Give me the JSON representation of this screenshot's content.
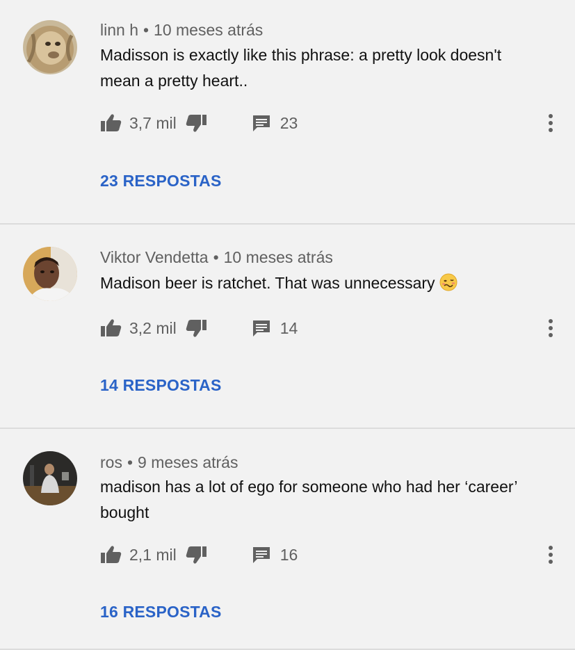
{
  "comments": [
    {
      "author": "linn h",
      "time": "10 meses atrás",
      "text": "Madisson is exactly like this phrase: a pretty look doesn't mean a pretty heart..",
      "likes": "3,7 mil",
      "reply_count": "23",
      "replies_label": "23 RESPOSTAS",
      "avatar_icon": "lion-photo"
    },
    {
      "author": "Viktor Vendetta",
      "time": "10 meses atrás",
      "text": "Madison beer is ratchet. That was unnecessary",
      "emoji": "woozy-face-emoji",
      "likes": "3,2 mil",
      "reply_count": "14",
      "replies_label": "14 RESPOSTAS",
      "avatar_icon": "person-photo"
    },
    {
      "author": "ros",
      "time": "9 meses atrás",
      "text": "madison has a lot of ego for someone who had her ‘career’ bought",
      "likes": "2,1 mil",
      "reply_count": "16",
      "replies_label": "16 RESPOSTAS",
      "avatar_icon": "dark-scene-photo"
    }
  ],
  "colors": {
    "background": "#f2f2f2",
    "link": "#2a63c7",
    "meta": "#606060",
    "icon": "#606060"
  }
}
